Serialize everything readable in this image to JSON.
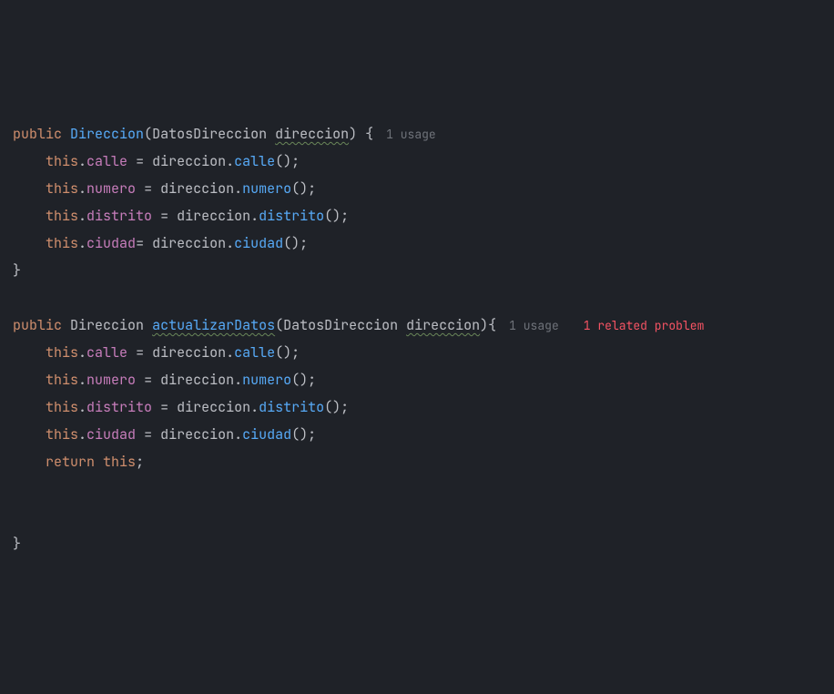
{
  "code": {
    "kw_public": "public",
    "kw_this": "this",
    "kw_return": "return",
    "type_Direccion": "Direccion",
    "type_DatosDireccion": "DatosDireccion",
    "fn_ctor": "Direccion",
    "fn_update": "actualizarDatos",
    "param": "direccion",
    "f_calle": "calle",
    "f_numero": "numero",
    "f_distrito": "distrito",
    "f_ciudad": "ciudad",
    "m_calle": "calle",
    "m_numero": "numero",
    "m_distrito": "distrito",
    "m_ciudad": "ciudad"
  },
  "hints": {
    "usage1": "1 usage",
    "usage2": "1 usage",
    "problem": "1 related problem"
  }
}
